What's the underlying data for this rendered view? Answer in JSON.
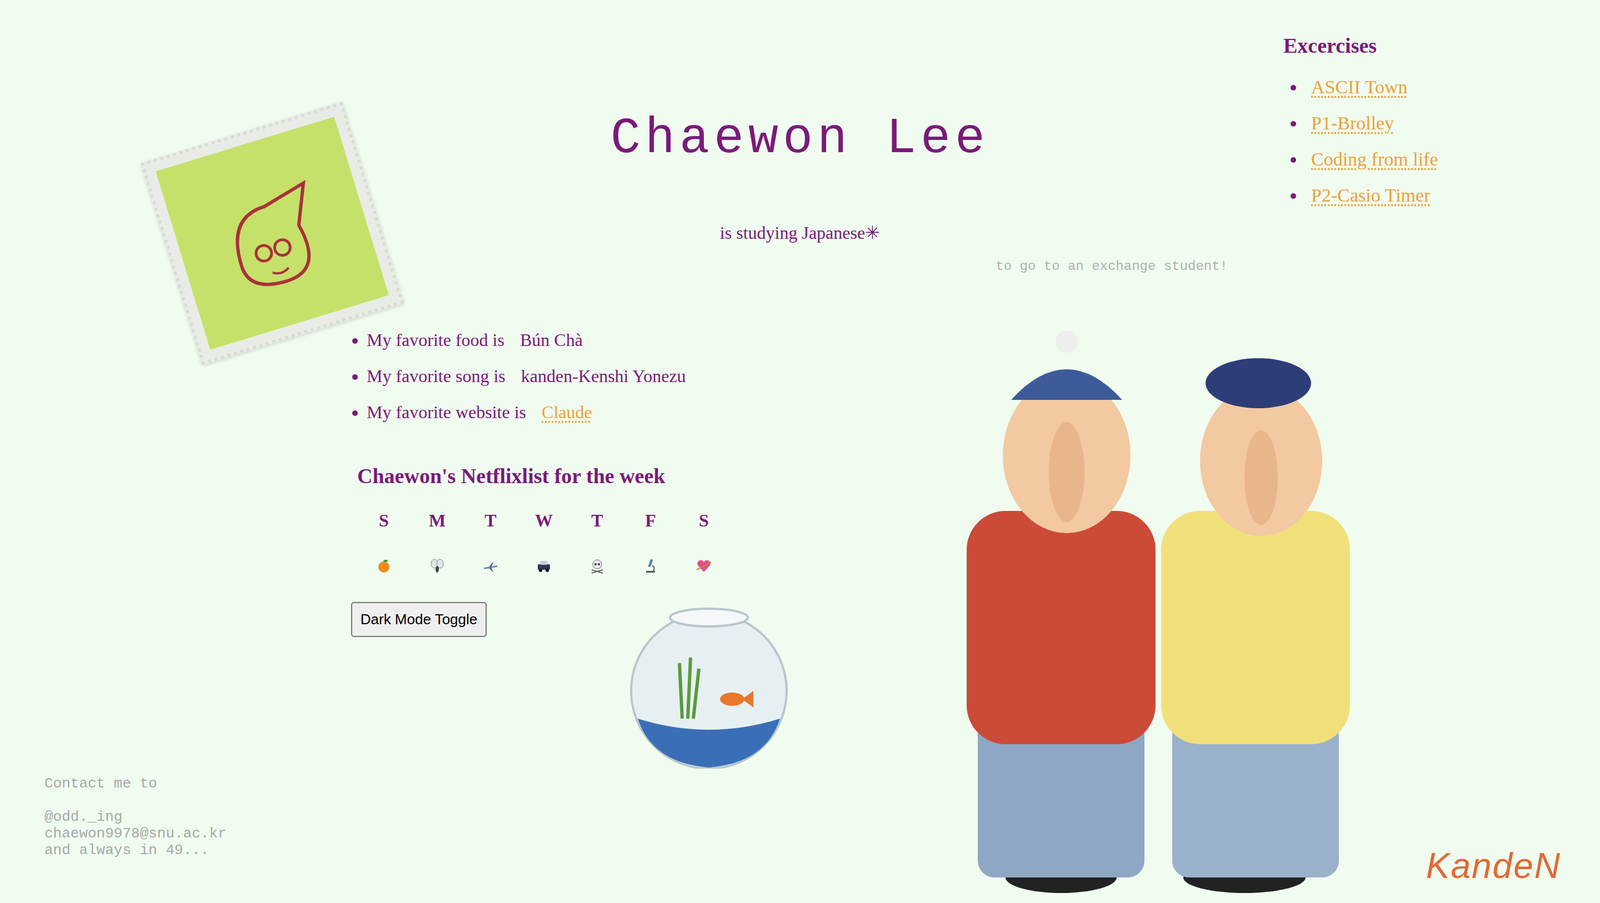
{
  "title": "Chaewon Lee",
  "subtitle": "is studying Japanese✳",
  "aside": "to go to an exchange student!",
  "favorites": [
    {
      "label": "My favorite food is",
      "value": "Bún Chà",
      "link": false
    },
    {
      "label": "My favorite song is",
      "value": "kanden-Kenshi Yonezu",
      "link": false
    },
    {
      "label": "My favorite website is",
      "value": "Claude",
      "link": true
    }
  ],
  "netflix": {
    "heading": "Chaewon's Netflixlist for the week",
    "days": [
      {
        "label": "S",
        "kind": "orange"
      },
      {
        "label": "M",
        "kind": "fly"
      },
      {
        "label": "T",
        "kind": "plane"
      },
      {
        "label": "W",
        "kind": "car"
      },
      {
        "label": "T",
        "kind": "skull"
      },
      {
        "label": "F",
        "kind": "microscope"
      },
      {
        "label": "S",
        "kind": "heart"
      }
    ]
  },
  "darkModeButton": "Dark Mode Toggle",
  "exercises": {
    "heading": "Excercises",
    "links": [
      "ASCII Town",
      "P1-Brolley",
      "Coding from life",
      "P2-Casio Timer"
    ]
  },
  "contact": {
    "heading": "Contact me to",
    "lines": [
      "@odd._ing",
      "chaewon9978@snu.ac.kr",
      "and always in 49..."
    ]
  },
  "logo": "KandeN"
}
